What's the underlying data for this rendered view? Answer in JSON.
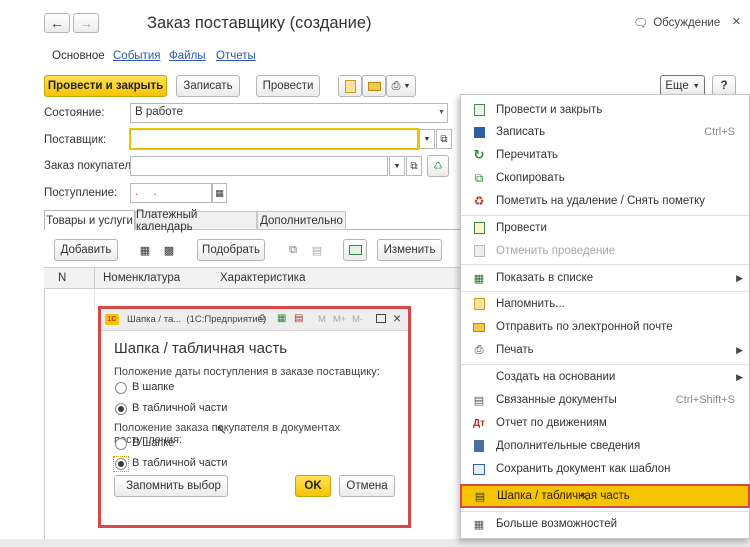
{
  "window": {
    "title": "Заказ поставщику (создание)",
    "discussion": "Обсуждение",
    "close": "×"
  },
  "tabs_top": [
    "Основное",
    "События",
    "Файлы",
    "Отчеты"
  ],
  "toolbar": {
    "post_close": "Провести и закрыть",
    "save": "Записать",
    "post": "Провести",
    "more": "Еще",
    "help": "?"
  },
  "form": {
    "state_label": "Состояние:",
    "state_value": "В работе",
    "supplier_label": "Поставщик:",
    "customer_order_label": "Заказ покупателя:",
    "receipt_label": "Поступление:"
  },
  "inner_tabs": [
    "Товары и услуги",
    "Платежный календарь",
    "Дополнительно"
  ],
  "table_toolbar": {
    "add": "Добавить",
    "pick": "Подобрать",
    "change": "Изменить"
  },
  "table_headers": [
    "N",
    "Номенклатура",
    "Характеристика"
  ],
  "dialog": {
    "window_title": "Шапка / та...  (1С:Предприятие)",
    "win_buttons": [
      "M",
      "M+",
      "M-"
    ],
    "heading": "Шапка / табличная часть",
    "group1_label": "Положение даты поступления в заказе поставщику:",
    "group2_label": "Положение заказа покупателя в документах поступления:",
    "opt_header": "В шапке",
    "opt_table": "В табличной части",
    "remember": "Запомнить выбор",
    "ok": "OK",
    "cancel": "Отмена"
  },
  "menu": {
    "items": [
      {
        "label": "Провести и закрыть",
        "shortcut": ""
      },
      {
        "label": "Записать",
        "shortcut": "Ctrl+S"
      },
      {
        "label": "Перечитать",
        "shortcut": ""
      },
      {
        "label": "Скопировать",
        "shortcut": ""
      },
      {
        "label": "Пометить на удаление / Снять пометку",
        "shortcut": ""
      },
      {
        "label": "Провести",
        "shortcut": ""
      },
      {
        "label": "Отменить проведение",
        "shortcut": ""
      },
      {
        "label": "Показать в списке",
        "shortcut": ""
      },
      {
        "label": "Напомнить...",
        "shortcut": ""
      },
      {
        "label": "Отправить по электронной почте",
        "shortcut": ""
      },
      {
        "label": "Печать",
        "shortcut": ""
      },
      {
        "label": "Создать на основании",
        "shortcut": ""
      },
      {
        "label": "Связанные документы",
        "shortcut": "Ctrl+Shift+S"
      },
      {
        "label": "Отчет по движениям",
        "shortcut": ""
      },
      {
        "label": "Дополнительные сведения",
        "shortcut": ""
      },
      {
        "label": "Сохранить документ как шаблон",
        "shortcut": ""
      },
      {
        "label": "Шапка / табличная часть",
        "shortcut": ""
      },
      {
        "label": "Больше возможностей",
        "shortcut": ""
      }
    ]
  },
  "colors": {
    "accent_yellow": "#f5c400",
    "dialog_border": "#d84848",
    "link_blue": "#2a5aa8"
  }
}
